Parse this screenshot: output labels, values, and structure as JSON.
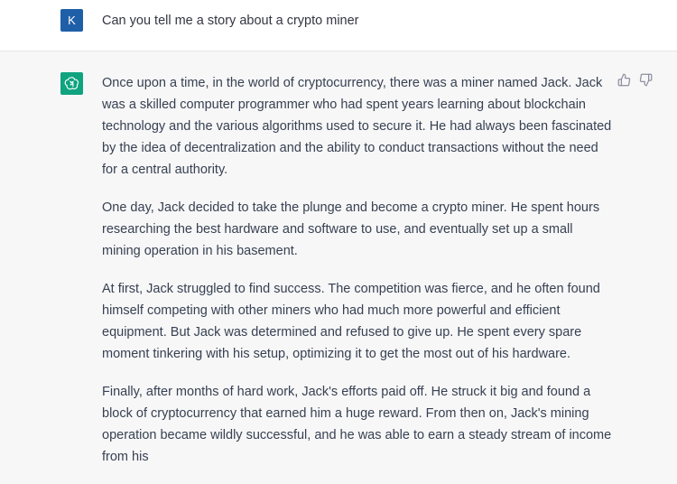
{
  "user_message": {
    "avatar_letter": "K",
    "text": "Can you tell me a story about a crypto miner"
  },
  "assistant_message": {
    "paragraphs": [
      "Once upon a time, in the world of cryptocurrency, there was a miner named Jack. Jack was a skilled computer programmer who had spent years learning about blockchain technology and the various algorithms used to secure it. He had always been fascinated by the idea of decentralization and the ability to conduct transactions without the need for a central authority.",
      "One day, Jack decided to take the plunge and become a crypto miner. He spent hours researching the best hardware and software to use, and eventually set up a small mining operation in his basement.",
      "At first, Jack struggled to find success. The competition was fierce, and he often found himself competing with other miners who had much more powerful and efficient equipment. But Jack was determined and refused to give up. He spent every spare moment tinkering with his setup, optimizing it to get the most out of his hardware.",
      "Finally, after months of hard work, Jack's efforts paid off. He struck it big and found a block of cryptocurrency that earned him a huge reward. From then on, Jack's mining operation became wildly successful, and he was able to earn a steady stream of income from his"
    ]
  },
  "icons": {
    "assistant_avatar": "openai-logo-icon",
    "thumbs_up": "thumbs-up-icon",
    "thumbs_down": "thumbs-down-icon"
  },
  "colors": {
    "user_avatar_bg": "#1f5fa8",
    "assistant_avatar_bg": "#10a37f",
    "assistant_row_bg": "#f7f7f8"
  }
}
